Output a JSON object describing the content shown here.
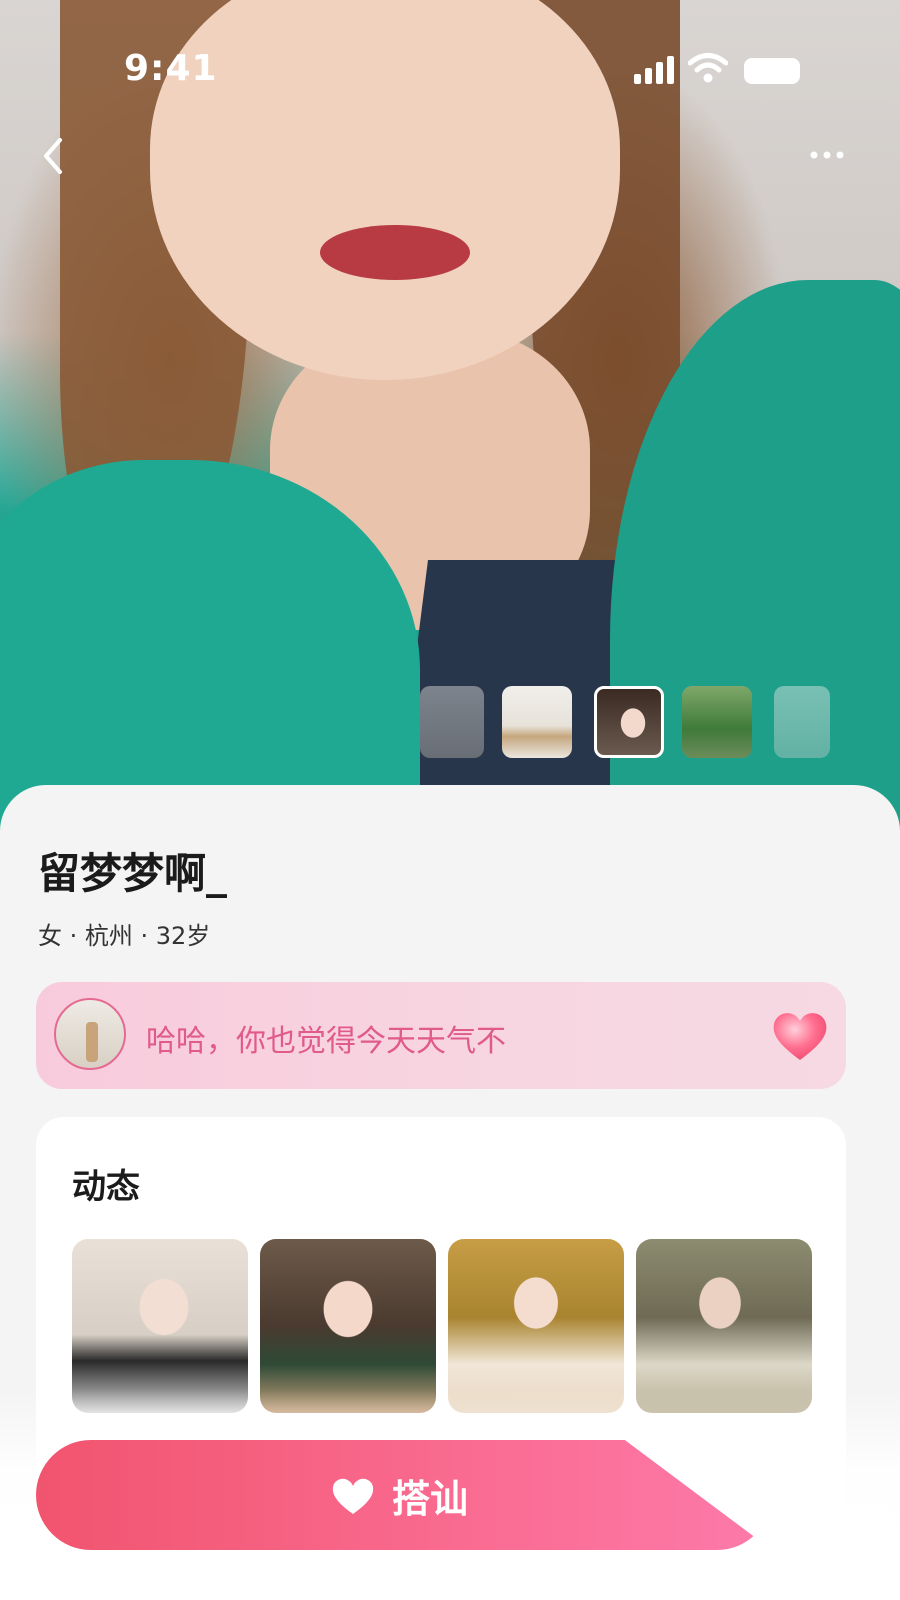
{
  "status_bar": {
    "time": "9:41"
  },
  "profile": {
    "nickname": "留梦梦啊_",
    "meta": "女 · 杭州 · 32岁"
  },
  "greeting": {
    "text": "哈哈，你也觉得今天天气不"
  },
  "moments": {
    "title": "动态"
  },
  "actions": {
    "chat_label": "搭讪"
  },
  "icons": [
    "back-icon",
    "more-icon",
    "signal-icon",
    "wifi-icon",
    "battery-icon",
    "heart-icon"
  ],
  "colors": {
    "accent_pink": "#f96a8f",
    "greeting_text": "#e05a8a",
    "greeting_bg": "#f8cbdc"
  }
}
